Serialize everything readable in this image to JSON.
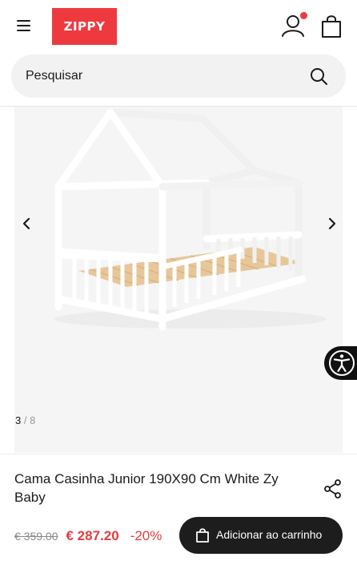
{
  "header": {
    "logo_text": "ZIPPY",
    "brand_color": "#ee3a3f",
    "notification_dot_color": "#ee3a3f",
    "icons": [
      "menu-icon",
      "user-icon",
      "shopping-bag-icon"
    ]
  },
  "search": {
    "placeholder": "Pesquisar",
    "icon": "search-icon"
  },
  "gallery": {
    "current": "3",
    "separator": "/",
    "total": "8",
    "prev_icon": "chevron-left-icon",
    "next_icon": "chevron-right-icon"
  },
  "accessibility": {
    "icon": "accessibility-icon"
  },
  "product": {
    "title": "Cama Casinha Junior 190X90 Cm White Zy Baby",
    "old_price": "€ 359.00",
    "new_price": "€ 287.20",
    "discount": "-20%",
    "price_color": "#e53b3e",
    "share_icon": "share-icon",
    "add_to_cart_label": "Adicionar ao carrinho"
  }
}
